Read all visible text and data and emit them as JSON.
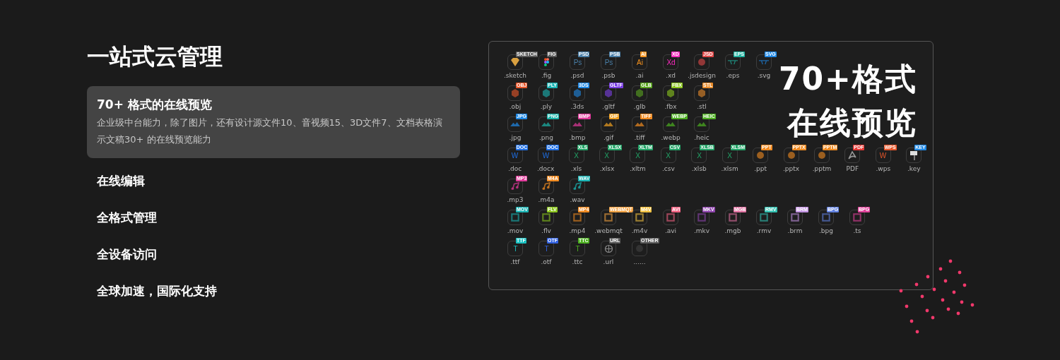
{
  "heading": "一站式云管理",
  "features": [
    {
      "title": "70+ 格式的在线预览",
      "description": "企业级中台能力，除了图片，还有设计源文件10、音视频15、3D文件7、文档表格演示文稿30+ 的在线预览能力",
      "selected": true
    },
    {
      "title": "在线编辑",
      "selected": false
    },
    {
      "title": "全格式管理",
      "selected": false
    },
    {
      "title": "全设备访问",
      "selected": false
    },
    {
      "title": "全球加速，国际化支持",
      "selected": false
    }
  ],
  "preview": {
    "headline": [
      "70+格式",
      "在线预览"
    ],
    "rows": [
      [
        {
          "kind": "diamond",
          "badge": "SKETCH",
          "label": ".sketch",
          "color": "#5a5a5a"
        },
        {
          "kind": "figma",
          "badge": "FIG",
          "label": ".fig",
          "color": "#5a5a5a"
        },
        {
          "kind": "text",
          "glyph": "Ps",
          "badge": "PSD",
          "label": ".psd",
          "color": "#4a7fa8"
        },
        {
          "kind": "text",
          "glyph": "Ps",
          "badge": "PSB",
          "label": ".psb",
          "color": "#4a7fa8"
        },
        {
          "kind": "text",
          "glyph": "Ai",
          "badge": "AI",
          "label": ".ai",
          "color": "#f7931e"
        },
        {
          "kind": "text",
          "glyph": "Xd",
          "badge": "XD",
          "label": ".xd",
          "color": "#ff2bc2"
        },
        {
          "kind": "circle",
          "badge": "JSD",
          "label": ".jsdesign",
          "color": "#e04848"
        },
        {
          "kind": "vector",
          "badge": "EPS",
          "label": ".eps",
          "color": "#1fb3a0"
        },
        {
          "kind": "vector",
          "badge": "SVG",
          "label": ".svg",
          "color": "#1e88e5"
        }
      ],
      [
        {
          "kind": "cube",
          "badge": "OBJ",
          "label": ".obj",
          "color": "#e8562a"
        },
        {
          "kind": "cube",
          "badge": "PLY",
          "label": ".ply",
          "color": "#19b3b3"
        },
        {
          "kind": "cube",
          "badge": "3DS",
          "label": ".3ds",
          "color": "#1e88e5"
        },
        {
          "kind": "cube",
          "badge": "GLTF",
          "label": ".gltf",
          "color": "#7b3fe4"
        },
        {
          "kind": "cube",
          "badge": "GLB",
          "label": ".glb",
          "color": "#5aa51f"
        },
        {
          "kind": "cube",
          "badge": "FBX",
          "label": ".fbx",
          "color": "#8bc61c"
        },
        {
          "kind": "cube",
          "badge": "STL",
          "label": ".stl",
          "color": "#e88b2a"
        }
      ],
      [
        {
          "kind": "image",
          "badge": "JPG",
          "label": ".jpg",
          "color": "#1e88e5"
        },
        {
          "kind": "image",
          "badge": "PNG",
          "label": ".png",
          "color": "#19b3a8"
        },
        {
          "kind": "image",
          "badge": "BMP",
          "label": ".bmp",
          "color": "#e0389a"
        },
        {
          "kind": "image",
          "badge": "GIF",
          "label": ".gif",
          "color": "#f0a020"
        },
        {
          "kind": "image",
          "badge": "TIFF",
          "label": ".tiff",
          "color": "#f08a20"
        },
        {
          "kind": "image",
          "badge": "WEBP",
          "label": ".webp",
          "color": "#4caf20"
        },
        {
          "kind": "image",
          "badge": "HEIC",
          "label": ".heic",
          "color": "#4caf20"
        }
      ],
      [
        {
          "kind": "text",
          "glyph": "W",
          "badge": "DOC",
          "label": ".doc",
          "color": "#1e6fe5"
        },
        {
          "kind": "text",
          "glyph": "W",
          "badge": "DOC",
          "label": ".docx",
          "color": "#1e6fe5"
        },
        {
          "kind": "text",
          "glyph": "X",
          "badge": "XLS",
          "label": ".xls",
          "color": "#21a366"
        },
        {
          "kind": "text",
          "glyph": "X",
          "badge": "XLSX",
          "label": ".xlsx",
          "color": "#21a366"
        },
        {
          "kind": "text",
          "glyph": "X",
          "badge": "XLTM",
          "label": ".xltm",
          "color": "#21a366"
        },
        {
          "kind": "text",
          "glyph": "X",
          "badge": "CSV",
          "label": ".csv",
          "color": "#21a366"
        },
        {
          "kind": "text",
          "glyph": "X",
          "badge": "XLSB",
          "label": ".xlsb",
          "color": "#21a366"
        },
        {
          "kind": "text",
          "glyph": "X",
          "badge": "XLSM",
          "label": ".xlsm",
          "color": "#21a366"
        },
        {
          "kind": "circle",
          "badge": "PPT",
          "label": ".ppt",
          "color": "#f08a20"
        },
        {
          "kind": "circle",
          "badge": "PPTX",
          "label": ".pptx",
          "color": "#f08a20"
        },
        {
          "kind": "circle",
          "badge": "PPTM",
          "label": ".pptm",
          "color": "#f08a20"
        },
        {
          "kind": "pdf",
          "badge": "PDF",
          "label": "PDF",
          "color": "#e53935"
        },
        {
          "kind": "text",
          "glyph": "W",
          "badge": "WPS",
          "label": ".wps",
          "color": "#e8562a"
        },
        {
          "kind": "easel",
          "badge": "KEY",
          "label": ".key",
          "color": "#1e88e5"
        }
      ],
      [
        {
          "kind": "audio",
          "badge": "MP3",
          "label": ".mp3",
          "color": "#e0389a"
        },
        {
          "kind": "audio",
          "badge": "M4A",
          "label": ".m4a",
          "color": "#f08a20"
        },
        {
          "kind": "audio",
          "badge": "WAV",
          "label": ".wav",
          "color": "#19b3b3"
        }
      ],
      [
        {
          "kind": "video",
          "badge": "MOV",
          "label": ".mov",
          "color": "#19b3b3"
        },
        {
          "kind": "video",
          "badge": "FLV",
          "label": ".flv",
          "color": "#8bc61c"
        },
        {
          "kind": "video",
          "badge": "MP4",
          "label": ".mp4",
          "color": "#f08a20"
        },
        {
          "kind": "video",
          "badge": "WEBMQT",
          "label": ".webmqt",
          "color": "#f0a040"
        },
        {
          "kind": "video",
          "badge": "M4V",
          "label": ".m4v",
          "color": "#f0c040"
        },
        {
          "kind": "video",
          "badge": "AVI",
          "label": ".avi",
          "color": "#f06080"
        },
        {
          "kind": "video",
          "badge": "MKV",
          "label": ".mkv",
          "color": "#8e44ad"
        },
        {
          "kind": "video",
          "badge": "MGB",
          "label": ".mgb",
          "color": "#e070a0"
        },
        {
          "kind": "video",
          "badge": "RMV",
          "label": ".rmv",
          "color": "#30c0b0"
        },
        {
          "kind": "video",
          "badge": "BRM",
          "label": ".brm",
          "color": "#c090e0"
        },
        {
          "kind": "video",
          "badge": "BPG",
          "label": ".bpg",
          "color": "#6080e0"
        },
        {
          "kind": "video",
          "badge": "BPG",
          "label": ".ts",
          "color": "#e0409a"
        }
      ],
      [
        {
          "kind": "text",
          "glyph": "T",
          "badge": "TTF",
          "label": ".ttf",
          "color": "#19c0c0"
        },
        {
          "kind": "text",
          "glyph": "T",
          "badge": "OTF",
          "label": ".otf",
          "color": "#3060e0"
        },
        {
          "kind": "text",
          "glyph": "T",
          "badge": "TTC",
          "label": ".ttc",
          "color": "#4caf20"
        },
        {
          "kind": "globe",
          "badge": "URL",
          "label": ".url",
          "color": "#5a5a5a"
        },
        {
          "kind": "blank",
          "badge": "OTHER",
          "label": "......",
          "color": "#5a5a5a"
        }
      ]
    ]
  }
}
